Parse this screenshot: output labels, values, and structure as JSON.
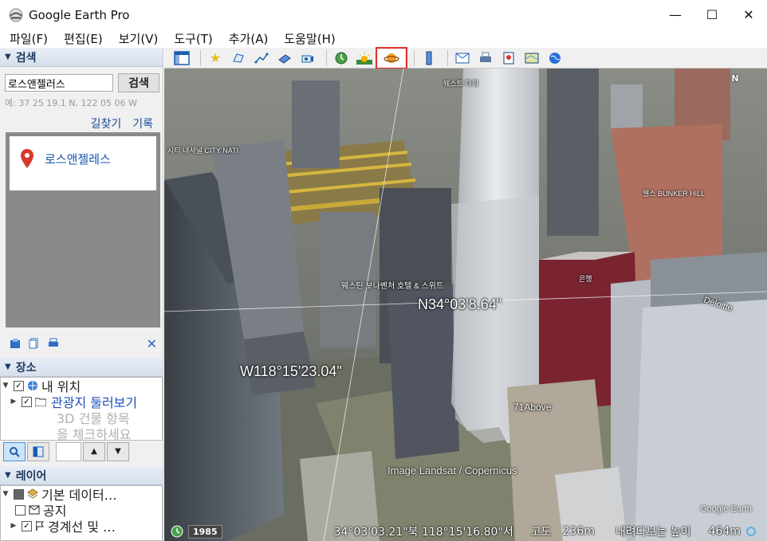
{
  "window": {
    "title": "Google Earth Pro",
    "min": "—",
    "max": "☐",
    "close": "✕"
  },
  "menu": [
    "파일(F)",
    "편집(E)",
    "보기(V)",
    "도구(T)",
    "추가(A)",
    "도움말(H)"
  ],
  "search": {
    "header": "검색",
    "input_value": "로스앤젤러스",
    "button": "검색",
    "hint": "예: 37 25 19.1 N, 122 05 06 W",
    "link_directions": "길찾기",
    "link_history": "기록",
    "result": "로스앤젤레스"
  },
  "places": {
    "header": "장소",
    "items": [
      {
        "label": "내 위치",
        "checked": true,
        "style": "normal"
      },
      {
        "label": "관광지 둘러보기",
        "checked": true,
        "style": "link"
      },
      {
        "label": "3D 건물 항목",
        "checked": false,
        "style": "gray"
      },
      {
        "label": "을 체크하세요",
        "checked": false,
        "style": "gray"
      }
    ]
  },
  "layers": {
    "header": "레이어",
    "items": [
      {
        "label": "기본 데이터…",
        "checked": true
      },
      {
        "label": "공지",
        "checked": false
      },
      {
        "label": "경계선 및 …",
        "checked": true
      }
    ]
  },
  "map": {
    "label_lat": "N34°03'8.64\"",
    "label_lon": "W118°15'23.04\"",
    "label_71above": "71Above",
    "label_city": "시티 내셔널 CITY NATI",
    "label_bunker": "웰스 BUNKER HILL",
    "label_hotel": "웨스틴 보나벤처 호텔 & 스위트",
    "label_bank": "은행",
    "label_deloitte": "Deloitte",
    "label_gehry": "웨스트 타워",
    "attribution": "Image Landsat / Copernicus",
    "watermark": "Google Earth",
    "north": "N"
  },
  "status": {
    "year": "1985",
    "coords": "34°03'03.21\"북  118°15'16.80\"서",
    "elev_label": "고도",
    "elev_value": "236m",
    "eye_label": "내려다보는 높이",
    "eye_value": "464m"
  }
}
